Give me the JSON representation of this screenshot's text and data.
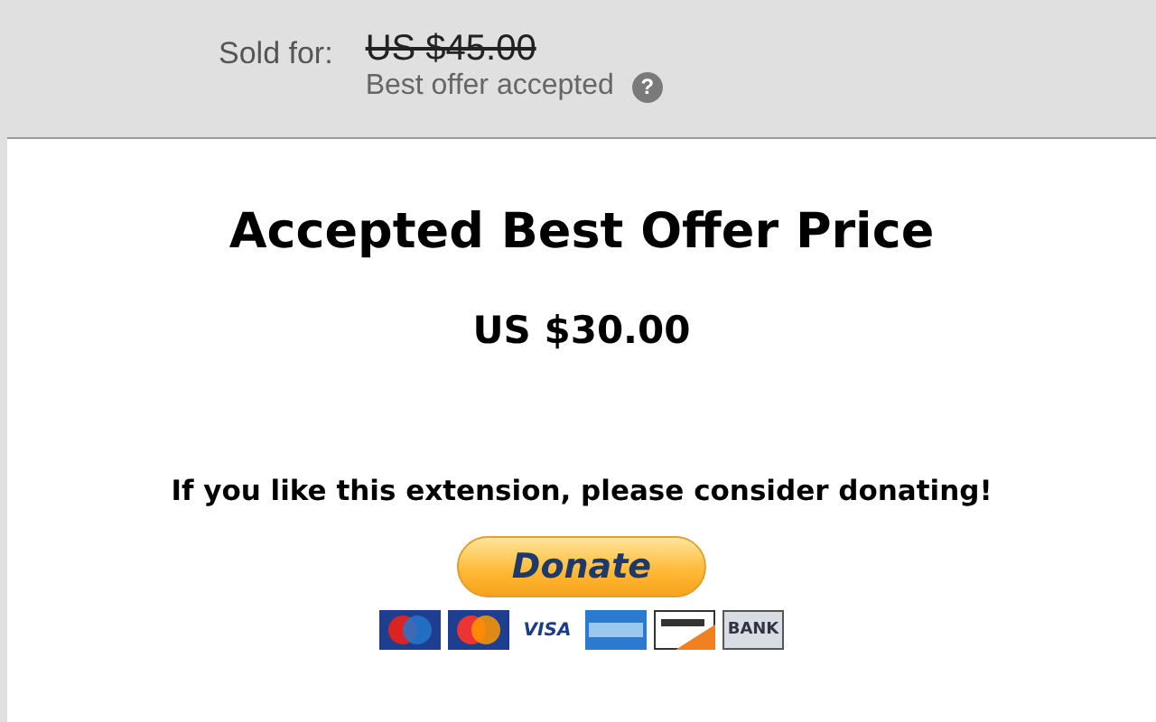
{
  "listing": {
    "sold_label": "Sold for:",
    "original_price": "US $45.00",
    "offer_note": "Best offer accepted",
    "help_icon": "?"
  },
  "popup": {
    "title": "Accepted Best Offer Price",
    "price": "US $30.00",
    "donate_message": "If you like this extension, please consider donating!",
    "donate_button": "Donate",
    "cards": [
      {
        "kind": "maestro"
      },
      {
        "kind": "mastercard"
      },
      {
        "kind": "visa",
        "label": "VISA"
      },
      {
        "kind": "amex"
      },
      {
        "kind": "discover"
      },
      {
        "kind": "bank",
        "label": "BANK"
      }
    ]
  }
}
